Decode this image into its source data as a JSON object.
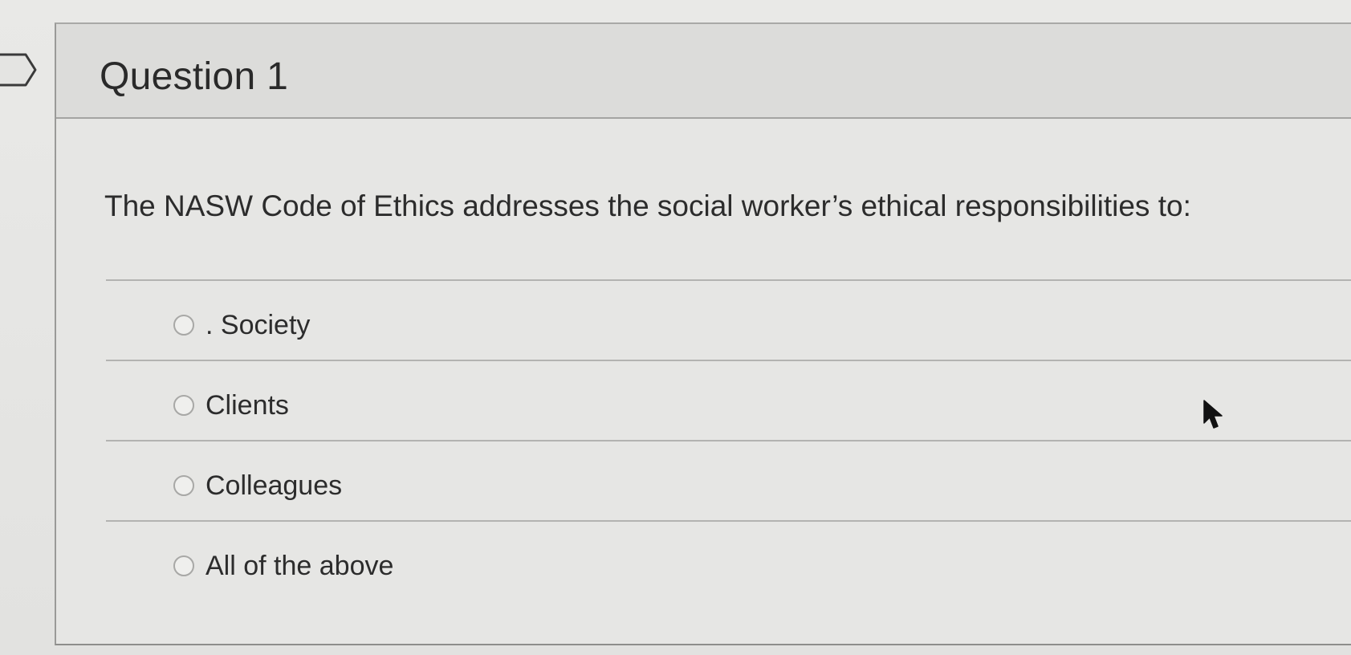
{
  "question": {
    "title": "Question 1",
    "prompt": "The NASW Code of Ethics addresses the social worker’s ethical responsibilities to:",
    "options": [
      {
        "label": ". Society"
      },
      {
        "label": "Clients"
      },
      {
        "label": "Colleagues"
      },
      {
        "label": "All of the above"
      }
    ]
  },
  "icons": {
    "flag": "flag-icon",
    "radio": "radio-unchecked-icon",
    "cursor": "mouse-pointer-icon"
  }
}
